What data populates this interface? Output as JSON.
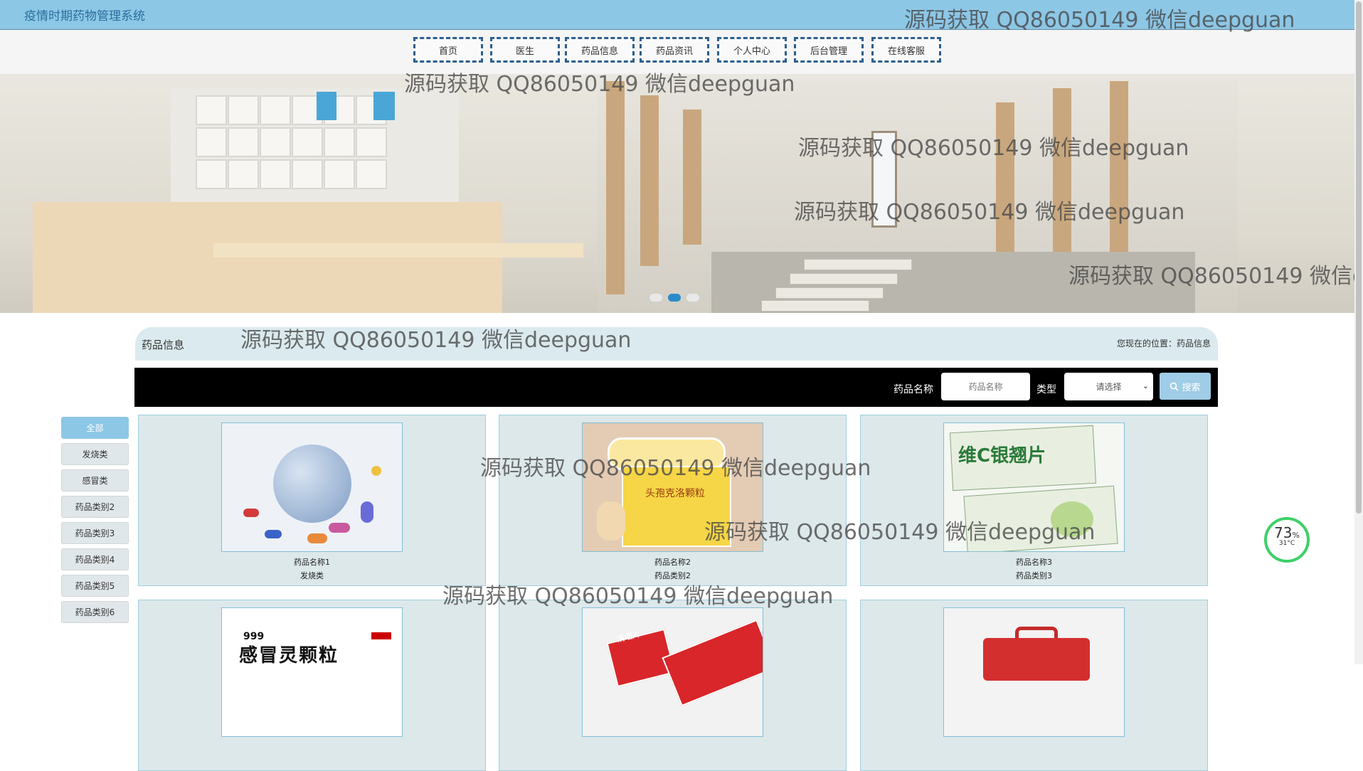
{
  "app": {
    "title": "疫情时期药物管理系统"
  },
  "nav": [
    {
      "label": "首页"
    },
    {
      "label": "医生"
    },
    {
      "label": "药品信息"
    },
    {
      "label": "药品资讯"
    },
    {
      "label": "个人中心"
    },
    {
      "label": "后台管理"
    },
    {
      "label": "在线客服"
    }
  ],
  "carousel": {
    "slides": 3,
    "active_index": 1
  },
  "section": {
    "title": "药品信息",
    "breadcrumb": "您现在的位置：药品信息"
  },
  "search": {
    "name_label": "药品名称",
    "name_placeholder": "药品名称",
    "type_label": "类型",
    "type_selected": "请选择",
    "button_label": "搜索"
  },
  "categories": [
    {
      "label": "全部",
      "active": true
    },
    {
      "label": "发烧类"
    },
    {
      "label": "感冒类"
    },
    {
      "label": "药品类别2"
    },
    {
      "label": "药品类别3"
    },
    {
      "label": "药品类别4"
    },
    {
      "label": "药品类别5"
    },
    {
      "label": "药品类别6"
    }
  ],
  "products": [
    {
      "name": "药品名称1",
      "category": "发烧类",
      "image": "pills-globe"
    },
    {
      "name": "药品名称2",
      "category": "药品类别2",
      "image": "cefaclor-box",
      "box_text": "头孢克洛颗粒"
    },
    {
      "name": "药品名称3",
      "category": "药品类别3",
      "image": "vc-yinqiao-box",
      "box_text": "维C银翘片"
    },
    {
      "name": "",
      "category": "",
      "image": "ganmaoling-box",
      "box_text": "感冒灵颗粒",
      "brand": "999"
    },
    {
      "name": "",
      "category": "",
      "image": "red-medicine-box",
      "box_text": "清咽片"
    },
    {
      "name": "",
      "category": "",
      "image": "first-aid-kit"
    }
  ],
  "watermarks": [
    "源码获取 QQ86050149 微信deepguan",
    "源码获取 QQ86050149 微信deepguan",
    "源码获取 QQ86050149 微信deepguan",
    "源码获取 QQ86050149 微信deepguan",
    "源码获取 QQ86050149 微信de",
    "源码获取 QQ86050149 微信deepguan",
    "源码获取 QQ86050149 微信deepguan",
    "源码获取 QQ86050149 微信deepguan",
    "源码获取 QQ86050149 微信deepguan"
  ],
  "widget": {
    "percent": "73",
    "percent_unit": "%",
    "temperature": "31°C"
  },
  "colors": {
    "topbar": "#8dc7e6",
    "accent": "#2a8ac9",
    "nav_border": "#2c5f8f",
    "card_bg": "#dde8ea",
    "gauge": "#3fcf6a"
  }
}
